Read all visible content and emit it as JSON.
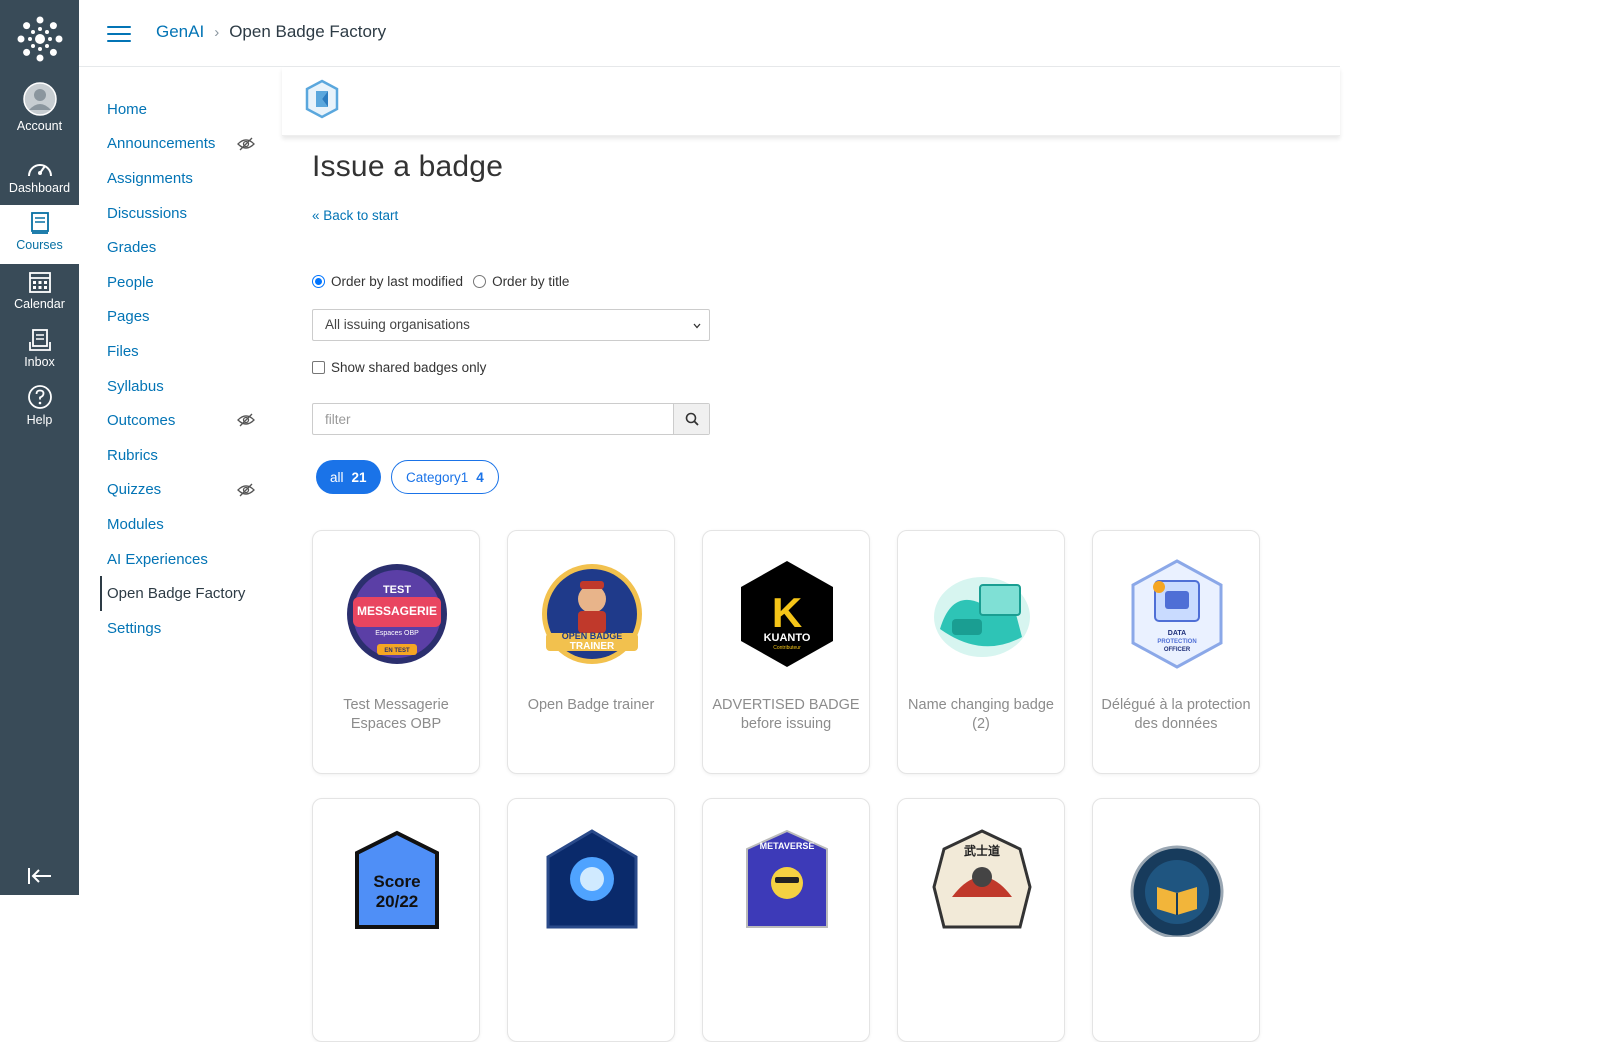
{
  "global_nav": {
    "items": [
      {
        "label": "Account",
        "icon": "account-avatar-icon"
      },
      {
        "label": "Dashboard",
        "icon": "dashboard-gauge-icon"
      },
      {
        "label": "Courses",
        "icon": "courses-book-icon",
        "active": true
      },
      {
        "label": "Calendar",
        "icon": "calendar-icon"
      },
      {
        "label": "Inbox",
        "icon": "inbox-icon"
      },
      {
        "label": "Help",
        "icon": "help-question-icon"
      }
    ]
  },
  "breadcrumb": {
    "course": "GenAI",
    "current": "Open Badge Factory"
  },
  "course_nav": {
    "items": [
      {
        "label": "Home"
      },
      {
        "label": "Announcements",
        "hidden_from_students": true
      },
      {
        "label": "Assignments"
      },
      {
        "label": "Discussions"
      },
      {
        "label": "Grades"
      },
      {
        "label": "People"
      },
      {
        "label": "Pages"
      },
      {
        "label": "Files"
      },
      {
        "label": "Syllabus"
      },
      {
        "label": "Outcomes",
        "hidden_from_students": true
      },
      {
        "label": "Rubrics"
      },
      {
        "label": "Quizzes",
        "hidden_from_students": true
      },
      {
        "label": "Modules"
      },
      {
        "label": "AI Experiences"
      },
      {
        "label": "Open Badge Factory",
        "active": true
      },
      {
        "label": "Settings"
      }
    ]
  },
  "main": {
    "title": "Issue a badge",
    "back_link": "« Back to start",
    "order_last_modified": "Order by last modified",
    "order_title": "Order by title",
    "org_select": "All issuing organisations",
    "shared_only": "Show shared badges only",
    "filter_placeholder": "filter",
    "pills": [
      {
        "label": "all",
        "count": "21"
      },
      {
        "label": "Category1",
        "count": "4"
      }
    ],
    "badges": [
      {
        "title": "Test Messagerie Espaces OBP"
      },
      {
        "title": "Open Badge trainer"
      },
      {
        "title": "ADVERTISED BADGE before issuing"
      },
      {
        "title": "Name changing badge (2)"
      },
      {
        "title": "Délégué à la protection des données"
      },
      {
        "title": ""
      },
      {
        "title": ""
      },
      {
        "title": ""
      },
      {
        "title": ""
      },
      {
        "title": ""
      }
    ],
    "badge_art_text": {
      "b1_top": "TEST",
      "b1_mid": "MESSAGERIE",
      "b1_sub": "Espaces OBP",
      "b1_bot": "EN TEST",
      "b2_top": "OPEN BADGE",
      "b2_bot": "TRAINER",
      "b3_letter": "K",
      "b3_name": "KUANTO",
      "b3_sub": "Contributeur",
      "b5_top": "DATA",
      "b5_mid": "PROTECTION",
      "b5_bot": "OFFICER",
      "b6_top": "Score",
      "b6_bot": "20/22",
      "b8_top": "METAVERSE",
      "b9_top": "武士道"
    }
  },
  "colors": {
    "nav_bg": "#394b58",
    "link": "#0374b5",
    "pill": "#1a73e8"
  }
}
